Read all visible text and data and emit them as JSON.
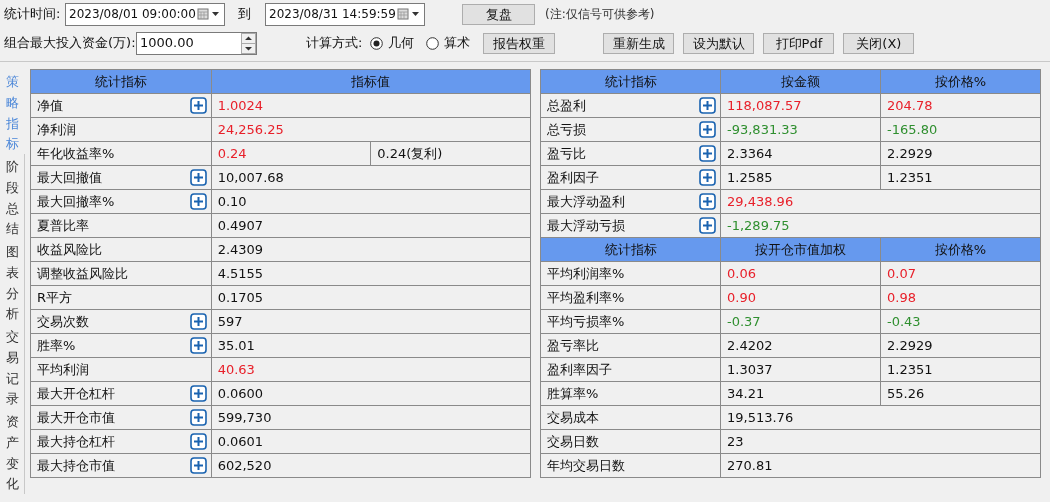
{
  "toolbar": {
    "time_label": "统计时间:",
    "start": "2023/08/01 09:00:00",
    "to_label": "到",
    "end": "2023/08/31 14:59:59",
    "replay_button": "复盘",
    "note": "(注:仅信号可供参考)",
    "capital_label": "组合最大投入资金(万):",
    "capital_value": "1000.00",
    "calc_label": "计算方式:",
    "modes": [
      {
        "label": "几何",
        "selected": true
      },
      {
        "label": "算术",
        "selected": false
      }
    ],
    "weight_button": "报告权重",
    "buttons": [
      "重新生成",
      "设为默认",
      "打印Pdf",
      "关闭(X)"
    ]
  },
  "side_tabs": [
    {
      "label": "策略指标",
      "selected": true
    },
    {
      "label": "阶段总结",
      "selected": false
    },
    {
      "label": "图表分析",
      "selected": false
    },
    {
      "label": "交易记录",
      "selected": false
    },
    {
      "label": "资产变化",
      "selected": false
    }
  ],
  "left_table": {
    "columns": [
      "统计指标",
      "指标值"
    ],
    "rows": [
      {
        "label": "净值",
        "expandable": true,
        "cells": [
          {
            "text": "1.0024",
            "color": "#e8202a"
          }
        ]
      },
      {
        "label": "净利润",
        "expandable": false,
        "cells": [
          {
            "text": "24,256.25",
            "color": "#e8202a"
          }
        ]
      },
      {
        "label": "年化收益率%",
        "expandable": false,
        "cells": [
          {
            "text": "0.24",
            "color": "#e8202a"
          },
          {
            "text": "0.24(复利)",
            "color": "#111111"
          }
        ]
      },
      {
        "label": "最大回撤值",
        "expandable": true,
        "cells": [
          {
            "text": "10,007.68",
            "color": "#111111"
          }
        ]
      },
      {
        "label": "最大回撤率%",
        "expandable": true,
        "cells": [
          {
            "text": "0.10",
            "color": "#111111"
          }
        ]
      },
      {
        "label": "夏普比率",
        "expandable": false,
        "cells": [
          {
            "text": "0.4907",
            "color": "#111111"
          }
        ]
      },
      {
        "label": "收益风险比",
        "expandable": false,
        "cells": [
          {
            "text": "2.4309",
            "color": "#111111"
          }
        ]
      },
      {
        "label": "调整收益风险比",
        "expandable": false,
        "cells": [
          {
            "text": "4.5155",
            "color": "#111111"
          }
        ]
      },
      {
        "label": "R平方",
        "expandable": false,
        "cells": [
          {
            "text": "0.1705",
            "color": "#111111"
          }
        ]
      },
      {
        "label": "交易次数",
        "expandable": true,
        "cells": [
          {
            "text": "597",
            "color": "#111111"
          }
        ]
      },
      {
        "label": "胜率%",
        "expandable": true,
        "cells": [
          {
            "text": "35.01",
            "color": "#111111"
          }
        ]
      },
      {
        "label": "平均利润",
        "expandable": false,
        "cells": [
          {
            "text": "40.63",
            "color": "#e8202a"
          }
        ]
      },
      {
        "label": "最大开仓杠杆",
        "expandable": true,
        "cells": [
          {
            "text": "0.0600",
            "color": "#111111"
          }
        ]
      },
      {
        "label": "最大开仓市值",
        "expandable": true,
        "cells": [
          {
            "text": "599,730",
            "color": "#111111"
          }
        ]
      },
      {
        "label": "最大持仓杠杆",
        "expandable": true,
        "cells": [
          {
            "text": "0.0601",
            "color": "#111111"
          }
        ]
      },
      {
        "label": "最大持仓市值",
        "expandable": true,
        "cells": [
          {
            "text": "602,520",
            "color": "#111111"
          }
        ]
      }
    ]
  },
  "right_sections": [
    {
      "columns": [
        "统计指标",
        "按金额",
        "按价格%"
      ],
      "rows": [
        {
          "label": "总盈利",
          "expandable": true,
          "cells": [
            {
              "text": "118,087.57",
              "color": "#e8202a"
            },
            {
              "text": "204.78",
              "color": "#e8202a"
            }
          ]
        },
        {
          "label": "总亏损",
          "expandable": true,
          "cells": [
            {
              "text": "-93,831.33",
              "color": "#2f8f2f"
            },
            {
              "text": "-165.80",
              "color": "#2f8f2f"
            }
          ]
        },
        {
          "label": "盈亏比",
          "expandable": true,
          "cells": [
            {
              "text": "2.3364",
              "color": "#111111"
            },
            {
              "text": "2.2929",
              "color": "#111111"
            }
          ]
        },
        {
          "label": "盈利因子",
          "expandable": true,
          "cells": [
            {
              "text": "1.2585",
              "color": "#111111"
            },
            {
              "text": "1.2351",
              "color": "#111111"
            }
          ]
        },
        {
          "label": "最大浮动盈利",
          "expandable": true,
          "cells": [
            {
              "text": "29,438.96",
              "color": "#e8202a"
            }
          ]
        },
        {
          "label": "最大浮动亏损",
          "expandable": true,
          "cells": [
            {
              "text": "-1,289.75",
              "color": "#2f8f2f"
            }
          ]
        }
      ]
    },
    {
      "columns": [
        "统计指标",
        "按开仓市值加权",
        "按价格%"
      ],
      "rows": [
        {
          "label": "平均利润率%",
          "expandable": false,
          "cells": [
            {
              "text": "0.06",
              "color": "#e8202a"
            },
            {
              "text": "0.07",
              "color": "#e8202a"
            }
          ]
        },
        {
          "label": "平均盈利率%",
          "expandable": false,
          "cells": [
            {
              "text": "0.90",
              "color": "#e8202a"
            },
            {
              "text": "0.98",
              "color": "#e8202a"
            }
          ]
        },
        {
          "label": "平均亏损率%",
          "expandable": false,
          "cells": [
            {
              "text": "-0.37",
              "color": "#2f8f2f"
            },
            {
              "text": "-0.43",
              "color": "#2f8f2f"
            }
          ]
        },
        {
          "label": "盈亏率比",
          "expandable": false,
          "cells": [
            {
              "text": "2.4202",
              "color": "#111111"
            },
            {
              "text": "2.2929",
              "color": "#111111"
            }
          ]
        },
        {
          "label": "盈利率因子",
          "expandable": false,
          "cells": [
            {
              "text": "1.3037",
              "color": "#111111"
            },
            {
              "text": "1.2351",
              "color": "#111111"
            }
          ]
        },
        {
          "label": "胜算率%",
          "expandable": false,
          "cells": [
            {
              "text": "34.21",
              "color": "#111111"
            },
            {
              "text": "55.26",
              "color": "#111111"
            }
          ]
        },
        {
          "label": "交易成本",
          "expandable": false,
          "cells": [
            {
              "text": "19,513.76",
              "color": "#111111"
            }
          ]
        },
        {
          "label": "交易日数",
          "expandable": false,
          "cells": [
            {
              "text": "23",
              "color": "#111111"
            }
          ]
        },
        {
          "label": "年均交易日数",
          "expandable": false,
          "cells": [
            {
              "text": "270.81",
              "color": "#111111"
            }
          ]
        }
      ]
    }
  ]
}
